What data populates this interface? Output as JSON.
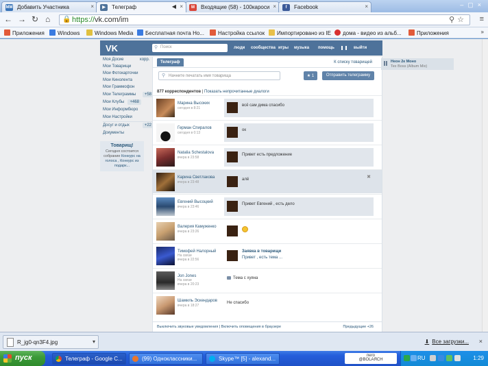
{
  "browser": {
    "tabs": [
      {
        "label": "Добавить Участника",
        "favicon": "ММ"
      },
      {
        "label": "Телеграф"
      },
      {
        "label": "Входящие (58) - 100кароси"
      },
      {
        "label": "Facebook"
      }
    ],
    "url_scheme": "https://",
    "url_rest": "vk.com/im",
    "bookmarks": [
      "Приложения",
      "Windows",
      "Windows Media",
      "Бесплатная почта Но...",
      "Настройка ссылок",
      "Импортировано из IE",
      "дома - видео из альб...",
      "Приложения"
    ],
    "more": "»"
  },
  "vk": {
    "logo": "VK",
    "search_placeholder": "Поиск",
    "nav": [
      "люди",
      "сообщества",
      "игры",
      "музыка",
      "помощь",
      "выйти"
    ],
    "left_menu": [
      {
        "label": "Моя Досие",
        "extra": "корр."
      },
      {
        "label": "Мои Товарищи"
      },
      {
        "label": "Мои Фотокарточки"
      },
      {
        "label": "Мои Кинолента"
      },
      {
        "label": "Мои Граммофон"
      },
      {
        "label": "Мои Телеграммы",
        "badge": "+58"
      },
      {
        "label": "Мои Клубы",
        "badge": "+468"
      },
      {
        "label": "Мои Информбюро"
      },
      {
        "label": "Мои Настройки"
      },
      {
        "label": "Досуг и отдых",
        "badge": "+22"
      },
      {
        "label": "Документы"
      }
    ],
    "promo": {
      "title": "Товарищ!",
      "text": "Сегодня состоится собрание ",
      "link": "Конкурс на голоса , Конкурс из подарк..."
    },
    "tab": "Телеграф",
    "back_link": "К списку товарищей",
    "compose_placeholder": "Начните печатать имя товарища",
    "star_label": "★ 1",
    "send_label": "Отправить телеграмму",
    "count_label": "877 корреспондентов",
    "count_link": "Показать непрочитанные диалоги",
    "dialogs": [
      {
        "name": "Марина Высоких",
        "date": "сегодня в 8:21",
        "message": "всё сам дима спасибо"
      },
      {
        "name": "Герман Спиралов",
        "date": "сегодня в 0:13",
        "message": "ок"
      },
      {
        "name": "Natalia Schestalova",
        "date": "вчера в 23:58",
        "message": "Привет есть предложение"
      },
      {
        "name": "Карина Светлакова",
        "date": "вчера в 23:48",
        "message": "алё"
      },
      {
        "name": "Евгений Высоцкий",
        "date": "вчера в 23:46",
        "message": "Привет Евгений , есть дело"
      },
      {
        "name": "Валерия Камуженко",
        "date": "вчера в 23:26",
        "message": ""
      },
      {
        "name": "Тимофей Налорный",
        "date": "вчера в 22:56",
        "status": "На связи",
        "title": "Заявка в товарищи",
        "message": "Привет , есть тема ..."
      },
      {
        "name": "Jon Jones",
        "date": "вчера в 20:23",
        "status": "На связи",
        "message": "Тема с хуяна"
      },
      {
        "name": "Шамиль Эскендаров",
        "date": "вчера в 18:27",
        "message": "Не спасибо"
      }
    ],
    "footer_left": "Выключить звуковые уведомления",
    "footer_mid": "Включить оповещения в браузере",
    "footer_right": "Предыдущие +26",
    "player_title": "Неон 2к Моно",
    "player_sub": "Tex Boss (Album Mix)"
  },
  "downloads": {
    "file": "R_jg0-qn3F4.jpg",
    "all": "Все загрузки..."
  },
  "taskbar": {
    "start": "пуск",
    "items": [
      "Телеграф - Google C...",
      "(99) Одноклассники...",
      "Skype™ [5] - alexand..."
    ],
    "lang_box": "пего\n@BOLAЯСН",
    "lang": "RU",
    "clock": "1:29"
  },
  "colors": {
    "vk_header": "#4e729a",
    "vk_link": "#2b587a",
    "button": "#6083a9"
  }
}
